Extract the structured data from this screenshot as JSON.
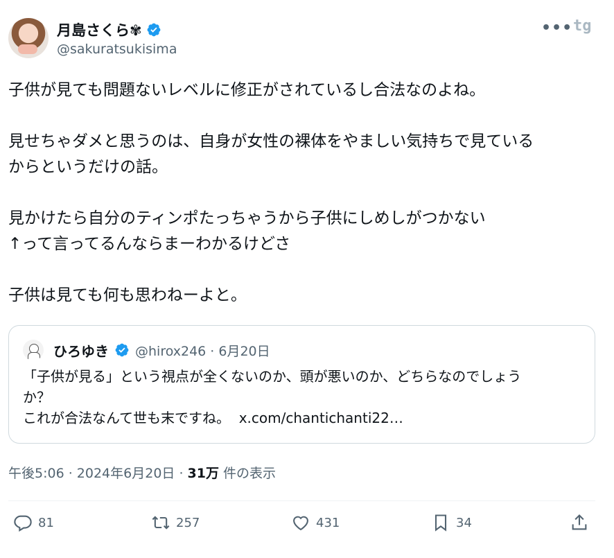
{
  "author": {
    "display_name": "月島さくら✾",
    "handle": "@sakuratsukisima"
  },
  "header_icons": {
    "more": "•••",
    "logo": "tg"
  },
  "tweet": {
    "paragraphs": [
      [
        "子供が見ても問題ないレベルに修正がされているし合法なのよね。"
      ],
      [
        "見せちゃダメと思うのは、自身が女性の裸体をやましい気持ちで見ている",
        "からというだけの話。"
      ],
      [
        "見かけたら自分のティンポたっちゃうから子供にしめしがつかない",
        "↑って言ってるんならまーわかるけどさ"
      ],
      [
        "子供は見ても何も思わねーよと。"
      ]
    ]
  },
  "quote": {
    "display_name": "ひろゆき",
    "handle_date": "@hirox246 · 6月20日",
    "lines": [
      "「子供が見る」という視点が全くないのか、頭が悪いのか、どちらなのでしょう",
      "か？",
      "これが合法なんて世も末ですね。"
    ],
    "link": "x.com/chantichanti22…"
  },
  "meta": {
    "time_date": "午後5:06 · 2024年6月20日 · ",
    "views_count": "31万",
    "views_label": " 件の表示"
  },
  "actions": {
    "replies": "81",
    "retweets": "257",
    "likes": "431",
    "bookmarks": "34"
  },
  "colors": {
    "verified": "#1d9bf0",
    "muted": "#536471",
    "text": "#0f1419",
    "border": "#cfd9de"
  }
}
